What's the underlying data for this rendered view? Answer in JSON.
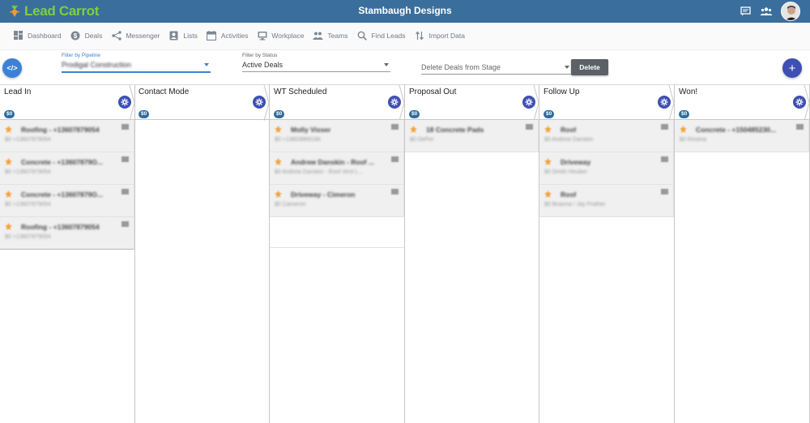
{
  "app": {
    "logo_text": "Lead Carrot",
    "title": "Stambaugh Designs",
    "brand_color": "#3a6e9c",
    "logo_color": "#7fcf3e"
  },
  "top_icons": [
    "message-icon",
    "people-icon",
    "user-avatar"
  ],
  "nav": [
    {
      "label": "Dashboard",
      "icon": "dashboard-icon"
    },
    {
      "label": "Deals",
      "icon": "dollar-icon"
    },
    {
      "label": "Messenger",
      "icon": "share-icon"
    },
    {
      "label": "Lists",
      "icon": "contact-list-icon"
    },
    {
      "label": "Activities",
      "icon": "calendar-icon"
    },
    {
      "label": "Workplace",
      "icon": "workplace-icon"
    },
    {
      "label": "Teams",
      "icon": "people-icon"
    },
    {
      "label": "Find Leads",
      "icon": "search-icon"
    },
    {
      "label": "Import Data",
      "icon": "import-icon"
    }
  ],
  "filters": {
    "pipeline": {
      "label": "Filter by Pipeline",
      "value": "Prodigal Construction"
    },
    "status": {
      "label": "Filter by Status",
      "value": "Active Deals"
    },
    "delete_stage": {
      "placeholder": "Delete Deals from Stage"
    }
  },
  "buttons": {
    "code": "</>",
    "delete": "Delete",
    "add": "+"
  },
  "columns": [
    {
      "name": "Lead In",
      "total": "$0",
      "cards": [
        {
          "title": "Roofing - +13607879054",
          "sub": "$0  +13607879054"
        },
        {
          "title": "Concrete - +13607879O...",
          "sub": "$0  +13607879054"
        },
        {
          "title": "Concrete - +13607879O...",
          "sub": "$0  +13607879054"
        },
        {
          "title": "Roofing - +13607879054",
          "sub": "$0  +13607879054"
        }
      ]
    },
    {
      "name": "Contact Mode",
      "total": "$0",
      "cards": []
    },
    {
      "name": "WT Scheduled",
      "total": "$0",
      "cards": [
        {
          "title": "Molly Visser",
          "sub": "$0  +13603869166"
        },
        {
          "title": "Andrew Danskin - Roof ...",
          "sub": "$0  Andrew Danskin - Roof Vent L..."
        },
        {
          "title": "Driveway - Cimeron",
          "sub": "$0  Cameron"
        }
      ]
    },
    {
      "name": "Proposal Out",
      "total": "$0",
      "cards": [
        {
          "title": "18 Concrete Pads",
          "sub": "$0  DePer"
        }
      ]
    },
    {
      "name": "Follow Up",
      "total": "$0",
      "cards": [
        {
          "title": "Roof",
          "sub": "$0  Andrew Danskin"
        },
        {
          "title": "Driveway",
          "sub": "$0  Dmitri Heuber"
        },
        {
          "title": "Roof",
          "sub": "$0  Brianna / Jay Prather"
        }
      ]
    },
    {
      "name": "Won!",
      "total": "$0",
      "cards": [
        {
          "title": "Concrete - +150485230...",
          "sub": "$0  Rosiina"
        }
      ]
    }
  ]
}
